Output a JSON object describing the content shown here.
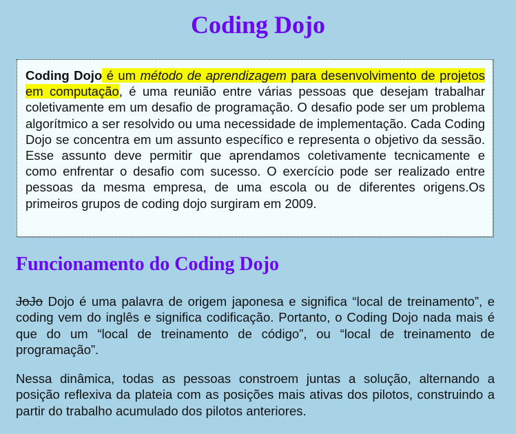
{
  "title": "Coding Dojo",
  "intro": {
    "bold_term": "Coding Dojo",
    "highlight_pre": " é um ",
    "highlight_italic": "método de aprendizagem",
    "highlight_post": " para desenvolvimento de projetos em computação",
    "rest": ", é uma reunião entre várias pessoas que desejam trabalhar coletivamente em um desafio de programação. O desafio pode ser um problema algorítmico a ser resolvido ou uma necessidade de implementação. Cada Coding Dojo se concentra em um assunto específico e representa o objetivo da sessão. Esse assunto deve permitir que aprendamos coletivamente tecnicamente e como enfrentar o desafio com sucesso. O exercício pode ser realizado entre pessoas da mesma empresa, de uma escola ou de diferentes origens.Os primeiros grupos de coding dojo surgiram em 2009."
  },
  "section": {
    "title": "Funcionamento do Coding Dojo",
    "paragraph1": {
      "struck": "JoJo",
      "text": " Dojo é uma palavra de origem japonesa e significa “local de treinamento”, e coding vem do inglês e significa codificação. Portanto, o Coding Dojo nada mais é que do um “local de treinamento de código”, ou “local de treinamento de programação”."
    },
    "paragraph2": "Nessa dinâmica, todas as pessoas constroem juntas a solução, alternando a posição reflexiva da plateia com as posições mais ativas dos pilotos, construindo a partir do trabalho acumulado dos pilotos anteriores."
  }
}
